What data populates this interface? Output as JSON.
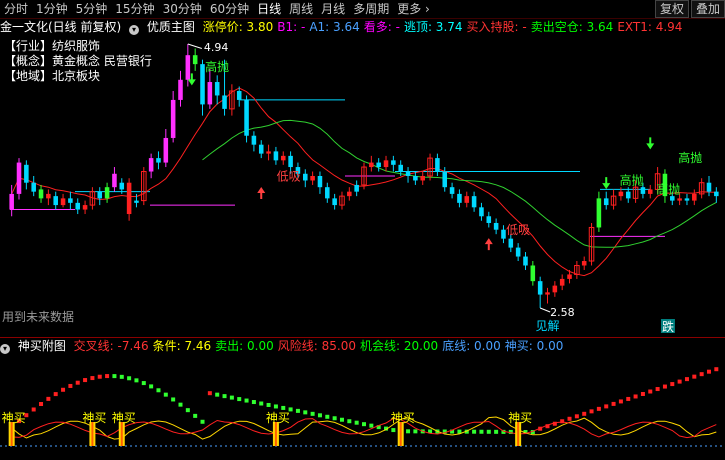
{
  "toolbar": {
    "periods": [
      "分时",
      "1分钟",
      "5分钟",
      "15分钟",
      "30分钟",
      "60分钟",
      "日线",
      "周线",
      "月线",
      "多周期",
      "更多"
    ],
    "active": "日线",
    "right_buttons": [
      "复权",
      "叠加"
    ]
  },
  "main_header": {
    "title": "金一文化(日线 前复权)",
    "indicator": "优质主图",
    "items": [
      {
        "label": "涨停价:",
        "value": "3.80",
        "color": "#ffff00"
      },
      {
        "label": "B1:",
        "value": "-",
        "color": "#ff00ff"
      },
      {
        "label": "A1:",
        "value": "3.64",
        "color": "#4aa0ff"
      },
      {
        "label": "看多:",
        "value": "-",
        "color": "#ff00ff"
      },
      {
        "label": "逃顶:",
        "value": "3.74",
        "color": "#00ffff"
      },
      {
        "label": "买入持股:",
        "value": "-",
        "color": "#ff3333"
      },
      {
        "label": "卖出空仓:",
        "value": "3.64",
        "color": "#00ff00"
      },
      {
        "label": "EXT1:",
        "value": "4.94",
        "color": "#ff3333"
      }
    ]
  },
  "info_box": [
    "【行业】纺织服饰",
    "【概念】黄金概念 民营银行",
    "【地域】北京板块"
  ],
  "future_note": "用到未来数据",
  "annotations": {
    "high_price": "4.94",
    "low_price": "2.58",
    "high_sell": "高抛",
    "low_buy": "低吸",
    "jie": "见解",
    "die": "跌",
    "buy": "神买"
  },
  "sub_header": {
    "title": "神买附图",
    "items": [
      {
        "label": "交叉线:",
        "value": "-7.46",
        "color": "#ff3333"
      },
      {
        "label": "条件:",
        "value": "7.46",
        "color": "#ffff00"
      },
      {
        "label": "卖出:",
        "value": "0.00",
        "color": "#00ff00"
      },
      {
        "label": "风险线:",
        "value": "85.00",
        "color": "#ff3333"
      },
      {
        "label": "机会线:",
        "value": "20.00",
        "color": "#00ff00"
      },
      {
        "label": "底线:",
        "value": "0.00",
        "color": "#4aa0ff"
      },
      {
        "label": "神买:",
        "value": "0.00",
        "color": "#4aa0ff"
      }
    ]
  },
  "chart_data": {
    "type": "candlestick",
    "price_max": 4.94,
    "price_min": 2.58,
    "series": [
      {
        "o": 3.46,
        "c": 3.6,
        "h": 3.68,
        "l": 3.4,
        "col": "m"
      },
      {
        "o": 3.6,
        "c": 3.88,
        "h": 3.92,
        "l": 3.55,
        "col": "m"
      },
      {
        "o": 3.86,
        "c": 3.7,
        "h": 3.9,
        "l": 3.64,
        "col": "c"
      },
      {
        "o": 3.7,
        "c": 3.62,
        "h": 3.76,
        "l": 3.58,
        "col": "c"
      },
      {
        "o": 3.64,
        "c": 3.56,
        "h": 3.68,
        "l": 3.52,
        "col": "g"
      },
      {
        "o": 3.56,
        "c": 3.6,
        "h": 3.64,
        "l": 3.5,
        "col": "r"
      },
      {
        "o": 3.58,
        "c": 3.5,
        "h": 3.62,
        "l": 3.46,
        "col": "c"
      },
      {
        "o": 3.5,
        "c": 3.56,
        "h": 3.6,
        "l": 3.48,
        "col": "r"
      },
      {
        "o": 3.56,
        "c": 3.52,
        "h": 3.62,
        "l": 3.46,
        "col": "c"
      },
      {
        "o": 3.52,
        "c": 3.46,
        "h": 3.56,
        "l": 3.42,
        "col": "c"
      },
      {
        "o": 3.46,
        "c": 3.5,
        "h": 3.54,
        "l": 3.42,
        "col": "r"
      },
      {
        "o": 3.5,
        "c": 3.62,
        "h": 3.66,
        "l": 3.46,
        "col": "r"
      },
      {
        "o": 3.62,
        "c": 3.56,
        "h": 3.66,
        "l": 3.5,
        "col": "c"
      },
      {
        "o": 3.56,
        "c": 3.66,
        "h": 3.7,
        "l": 3.52,
        "col": "g"
      },
      {
        "o": 3.66,
        "c": 3.78,
        "h": 3.84,
        "l": 3.62,
        "col": "m"
      },
      {
        "o": 3.64,
        "c": 3.7,
        "h": 3.74,
        "l": 3.6,
        "col": "c"
      },
      {
        "o": 3.7,
        "c": 3.42,
        "h": 3.74,
        "l": 3.36,
        "col": "r"
      },
      {
        "o": 3.52,
        "c": 3.54,
        "h": 3.6,
        "l": 3.48,
        "col": "c"
      },
      {
        "o": 3.54,
        "c": 3.8,
        "h": 3.84,
        "l": 3.5,
        "col": "r"
      },
      {
        "o": 3.8,
        "c": 3.92,
        "h": 3.96,
        "l": 3.74,
        "col": "m"
      },
      {
        "o": 3.92,
        "c": 3.88,
        "h": 3.98,
        "l": 3.82,
        "col": "c"
      },
      {
        "o": 3.88,
        "c": 4.1,
        "h": 4.18,
        "l": 3.84,
        "col": "m"
      },
      {
        "o": 4.1,
        "c": 4.44,
        "h": 4.52,
        "l": 4.06,
        "col": "m"
      },
      {
        "o": 4.44,
        "c": 4.62,
        "h": 4.7,
        "l": 4.38,
        "col": "m"
      },
      {
        "o": 4.62,
        "c": 4.84,
        "h": 4.94,
        "l": 4.56,
        "col": "m"
      },
      {
        "o": 4.84,
        "c": 4.76,
        "h": 4.9,
        "l": 4.7,
        "col": "g"
      },
      {
        "o": 4.76,
        "c": 4.4,
        "h": 4.8,
        "l": 4.3,
        "col": "c"
      },
      {
        "o": 4.4,
        "c": 4.6,
        "h": 4.72,
        "l": 4.36,
        "col": "m"
      },
      {
        "o": 4.6,
        "c": 4.48,
        "h": 4.66,
        "l": 4.4,
        "col": "c"
      },
      {
        "o": 4.48,
        "c": 4.36,
        "h": 4.8,
        "l": 4.3,
        "col": "c"
      },
      {
        "o": 4.36,
        "c": 4.52,
        "h": 4.58,
        "l": 4.3,
        "col": "r"
      },
      {
        "o": 4.52,
        "c": 4.44,
        "h": 4.56,
        "l": 4.38,
        "col": "c"
      },
      {
        "o": 4.44,
        "c": 4.12,
        "h": 4.48,
        "l": 4.06,
        "col": "c"
      },
      {
        "o": 4.12,
        "c": 4.04,
        "h": 4.16,
        "l": 3.98,
        "col": "c"
      },
      {
        "o": 4.04,
        "c": 3.96,
        "h": 4.08,
        "l": 3.92,
        "col": "c"
      },
      {
        "o": 3.96,
        "c": 3.98,
        "h": 4.04,
        "l": 3.9,
        "col": "r"
      },
      {
        "o": 3.98,
        "c": 3.9,
        "h": 4.02,
        "l": 3.86,
        "col": "c"
      },
      {
        "o": 3.9,
        "c": 3.94,
        "h": 3.98,
        "l": 3.86,
        "col": "r"
      },
      {
        "o": 3.94,
        "c": 3.84,
        "h": 3.98,
        "l": 3.78,
        "col": "c"
      },
      {
        "o": 3.84,
        "c": 3.78,
        "h": 3.88,
        "l": 3.74,
        "col": "c"
      },
      {
        "o": 3.78,
        "c": 3.72,
        "h": 3.82,
        "l": 3.66,
        "col": "c"
      },
      {
        "o": 3.72,
        "c": 3.76,
        "h": 3.8,
        "l": 3.68,
        "col": "r"
      },
      {
        "o": 3.76,
        "c": 3.66,
        "h": 3.8,
        "l": 3.6,
        "col": "c"
      },
      {
        "o": 3.66,
        "c": 3.56,
        "h": 3.7,
        "l": 3.52,
        "col": "c"
      },
      {
        "o": 3.56,
        "c": 3.5,
        "h": 3.6,
        "l": 3.46,
        "col": "c"
      },
      {
        "o": 3.5,
        "c": 3.58,
        "h": 3.62,
        "l": 3.46,
        "col": "r"
      },
      {
        "o": 3.58,
        "c": 3.62,
        "h": 3.66,
        "l": 3.54,
        "col": "r"
      },
      {
        "o": 3.62,
        "c": 3.68,
        "h": 3.72,
        "l": 3.58,
        "col": "c"
      },
      {
        "o": 3.68,
        "c": 3.84,
        "h": 3.88,
        "l": 3.64,
        "col": "r"
      },
      {
        "o": 3.84,
        "c": 3.88,
        "h": 3.94,
        "l": 3.8,
        "col": "r"
      },
      {
        "o": 3.88,
        "c": 3.84,
        "h": 3.92,
        "l": 3.8,
        "col": "c"
      },
      {
        "o": 3.84,
        "c": 3.9,
        "h": 3.94,
        "l": 3.8,
        "col": "r"
      },
      {
        "o": 3.9,
        "c": 3.86,
        "h": 3.94,
        "l": 3.8,
        "col": "c"
      },
      {
        "o": 3.86,
        "c": 3.8,
        "h": 3.9,
        "l": 3.76,
        "col": "c"
      },
      {
        "o": 3.8,
        "c": 3.76,
        "h": 3.84,
        "l": 3.7,
        "col": "c"
      },
      {
        "o": 3.76,
        "c": 3.72,
        "h": 3.8,
        "l": 3.68,
        "col": "c"
      },
      {
        "o": 3.72,
        "c": 3.76,
        "h": 3.8,
        "l": 3.68,
        "col": "r"
      },
      {
        "o": 3.76,
        "c": 3.92,
        "h": 3.96,
        "l": 3.72,
        "col": "r"
      },
      {
        "o": 3.92,
        "c": 3.8,
        "h": 3.96,
        "l": 3.76,
        "col": "c"
      },
      {
        "o": 3.8,
        "c": 3.66,
        "h": 3.84,
        "l": 3.62,
        "col": "c"
      },
      {
        "o": 3.66,
        "c": 3.6,
        "h": 3.7,
        "l": 3.56,
        "col": "c"
      },
      {
        "o": 3.6,
        "c": 3.52,
        "h": 3.64,
        "l": 3.48,
        "col": "c"
      },
      {
        "o": 3.52,
        "c": 3.58,
        "h": 3.62,
        "l": 3.48,
        "col": "r"
      },
      {
        "o": 3.58,
        "c": 3.48,
        "h": 3.62,
        "l": 3.44,
        "col": "c"
      },
      {
        "o": 3.48,
        "c": 3.4,
        "h": 3.52,
        "l": 3.36,
        "col": "c"
      },
      {
        "o": 3.4,
        "c": 3.34,
        "h": 3.44,
        "l": 3.3,
        "col": "c"
      },
      {
        "o": 3.34,
        "c": 3.28,
        "h": 3.38,
        "l": 3.24,
        "col": "c"
      },
      {
        "o": 3.28,
        "c": 3.2,
        "h": 3.32,
        "l": 3.16,
        "col": "c"
      },
      {
        "o": 3.2,
        "c": 3.12,
        "h": 3.24,
        "l": 3.08,
        "col": "c"
      },
      {
        "o": 3.12,
        "c": 3.04,
        "h": 3.16,
        "l": 3.0,
        "col": "c"
      },
      {
        "o": 3.04,
        "c": 2.96,
        "h": 3.08,
        "l": 2.92,
        "col": "c"
      },
      {
        "o": 2.96,
        "c": 2.82,
        "h": 3.0,
        "l": 2.78,
        "col": "g"
      },
      {
        "o": 2.82,
        "c": 2.7,
        "h": 2.86,
        "l": 2.58,
        "col": "c"
      },
      {
        "o": 2.7,
        "c": 2.72,
        "h": 2.76,
        "l": 2.62,
        "col": "r"
      },
      {
        "o": 2.72,
        "c": 2.78,
        "h": 2.82,
        "l": 2.68,
        "col": "r"
      },
      {
        "o": 2.78,
        "c": 2.84,
        "h": 2.88,
        "l": 2.74,
        "col": "r"
      },
      {
        "o": 2.84,
        "c": 2.88,
        "h": 2.92,
        "l": 2.8,
        "col": "r"
      },
      {
        "o": 2.88,
        "c": 2.96,
        "h": 3.0,
        "l": 2.84,
        "col": "r"
      },
      {
        "o": 2.96,
        "c": 3.0,
        "h": 3.04,
        "l": 2.92,
        "col": "r"
      },
      {
        "o": 3.0,
        "c": 3.3,
        "h": 3.34,
        "l": 2.96,
        "col": "r"
      },
      {
        "o": 3.3,
        "c": 3.56,
        "h": 3.62,
        "l": 3.26,
        "col": "g"
      },
      {
        "o": 3.56,
        "c": 3.5,
        "h": 3.62,
        "l": 3.46,
        "col": "c"
      },
      {
        "o": 3.5,
        "c": 3.58,
        "h": 3.64,
        "l": 3.46,
        "col": "r"
      },
      {
        "o": 3.58,
        "c": 3.62,
        "h": 3.66,
        "l": 3.54,
        "col": "r"
      },
      {
        "o": 3.62,
        "c": 3.56,
        "h": 3.66,
        "l": 3.52,
        "col": "c"
      },
      {
        "o": 3.56,
        "c": 3.66,
        "h": 3.72,
        "l": 3.52,
        "col": "r"
      },
      {
        "o": 3.66,
        "c": 3.6,
        "h": 3.7,
        "l": 3.56,
        "col": "c"
      },
      {
        "o": 3.6,
        "c": 3.64,
        "h": 3.68,
        "l": 3.56,
        "col": "r"
      },
      {
        "o": 3.64,
        "c": 3.78,
        "h": 3.84,
        "l": 3.6,
        "col": "r"
      },
      {
        "o": 3.78,
        "c": 3.58,
        "h": 3.82,
        "l": 3.52,
        "col": "g"
      },
      {
        "o": 3.58,
        "c": 3.54,
        "h": 3.62,
        "l": 3.5,
        "col": "c"
      },
      {
        "o": 3.54,
        "c": 3.56,
        "h": 3.6,
        "l": 3.5,
        "col": "r"
      },
      {
        "o": 3.56,
        "c": 3.54,
        "h": 3.6,
        "l": 3.5,
        "col": "c"
      },
      {
        "o": 3.54,
        "c": 3.6,
        "h": 3.64,
        "l": 3.5,
        "col": "r"
      },
      {
        "o": 3.6,
        "c": 3.7,
        "h": 3.74,
        "l": 3.56,
        "col": "r"
      },
      {
        "o": 3.7,
        "c": 3.62,
        "h": 3.76,
        "l": 3.58,
        "col": "c"
      },
      {
        "o": 3.62,
        "c": 3.58,
        "h": 3.66,
        "l": 3.52,
        "col": "c"
      }
    ]
  }
}
